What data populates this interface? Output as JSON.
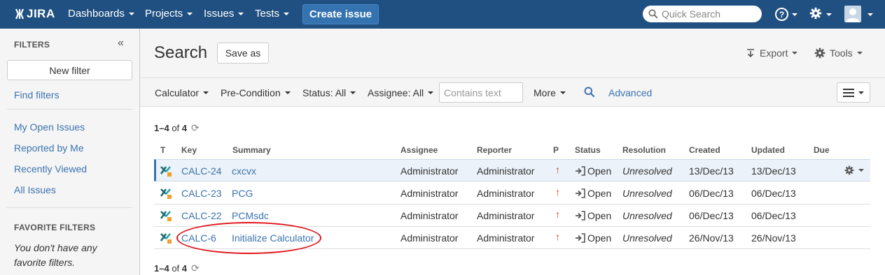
{
  "topnav": {
    "logo": "JIRA",
    "items": [
      "Dashboards",
      "Projects",
      "Issues",
      "Tests"
    ],
    "create_label": "Create issue",
    "search_placeholder": "Quick Search",
    "help_symbol": "?"
  },
  "sidebar": {
    "title": "FILTERS",
    "collapse_symbol": "«",
    "new_filter": "New filter",
    "find_filters": "Find filters",
    "links": [
      "My Open Issues",
      "Reported by Me",
      "Recently Viewed",
      "All Issues"
    ],
    "favorites_title": "FAVORITE FILTERS",
    "favorites_empty": "You don't have any favorite filters."
  },
  "header": {
    "title": "Search",
    "save_as": "Save as",
    "export": "Export",
    "tools": "Tools"
  },
  "filterbar": {
    "project": "Calculator",
    "type": "Pre-Condition",
    "status": "Status: All",
    "assignee": "Assignee: All",
    "text_placeholder": "Contains text",
    "more": "More",
    "advanced": "Advanced"
  },
  "results": {
    "count_range": "1–4",
    "count_of": "of",
    "count_total": "4",
    "columns": [
      "T",
      "Key",
      "Summary",
      "Assignee",
      "Reporter",
      "P",
      "Status",
      "Resolution",
      "Created",
      "Updated",
      "Due"
    ],
    "rows": [
      {
        "key": "CALC-24",
        "summary": "cxcvx",
        "assignee": "Administrator",
        "reporter": "Administrator",
        "priority": "↑",
        "status": "Open",
        "resolution": "Unresolved",
        "created": "13/Dec/13",
        "updated": "13/Dec/13",
        "due": ""
      },
      {
        "key": "CALC-23",
        "summary": "PCG",
        "assignee": "Administrator",
        "reporter": "Administrator",
        "priority": "↑",
        "status": "Open",
        "resolution": "Unresolved",
        "created": "06/Dec/13",
        "updated": "06/Dec/13",
        "due": ""
      },
      {
        "key": "CALC-22",
        "summary": "PCMsdc",
        "assignee": "Administrator",
        "reporter": "Administrator",
        "priority": "↑",
        "status": "Open",
        "resolution": "Unresolved",
        "created": "06/Dec/13",
        "updated": "06/Dec/13",
        "due": ""
      },
      {
        "key": "CALC-6",
        "summary": "Initialize Calculator",
        "assignee": "Administrator",
        "reporter": "Administrator",
        "priority": "↑",
        "status": "Open",
        "resolution": "Unresolved",
        "created": "26/Nov/13",
        "updated": "26/Nov/13",
        "due": ""
      }
    ]
  },
  "colors": {
    "topbar": "#205081",
    "link": "#3b73af",
    "annotation": "#e0121a",
    "priority": "#cc3a23"
  },
  "icons": {
    "type": "test-type-icon",
    "status": "open-status-icon",
    "priority": "priority-major-arrow-icon"
  }
}
